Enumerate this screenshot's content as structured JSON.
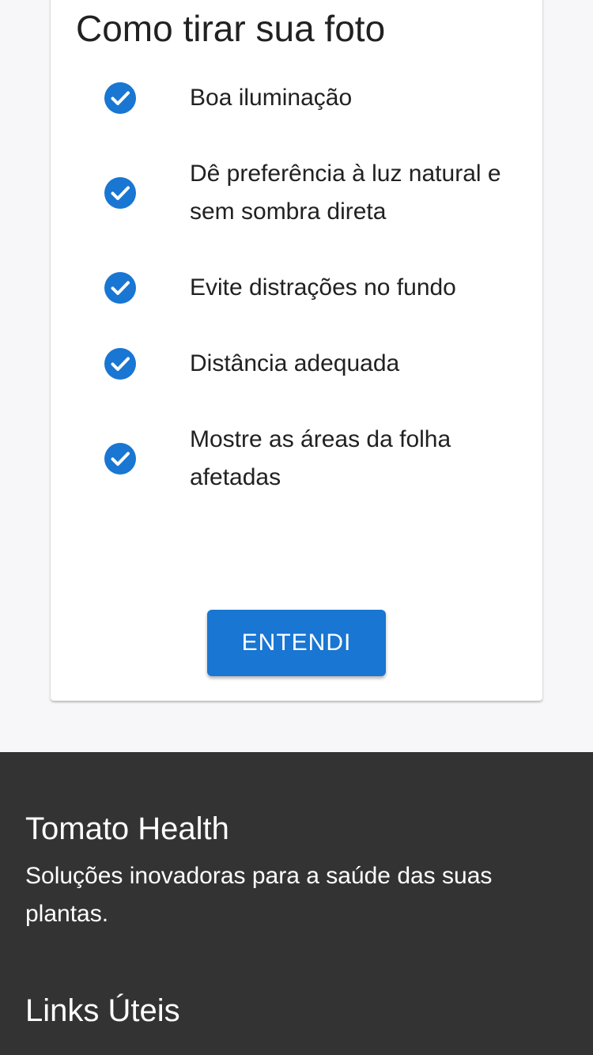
{
  "card": {
    "title": "Como tirar sua foto",
    "tips": [
      {
        "icon": "check-circle-icon",
        "text": "Boa iluminação"
      },
      {
        "icon": "check-circle-icon",
        "text": "Dê preferência à luz natural e sem sombra direta"
      },
      {
        "icon": "check-circle-icon",
        "text": "Evite distrações no fundo"
      },
      {
        "icon": "check-circle-icon",
        "text": "Distância adequada"
      },
      {
        "icon": "check-circle-icon",
        "text": "Mostre as áreas da folha afetadas"
      }
    ],
    "button_label": "ENTENDI"
  },
  "footer": {
    "brand": "Tomato Health",
    "description": "Soluções inovadoras para a saúde das suas plantas.",
    "links_heading": "Links Úteis"
  },
  "colors": {
    "accent": "#1976d2",
    "footer_bg": "#333333",
    "page_bg": "#f7f7f9"
  }
}
